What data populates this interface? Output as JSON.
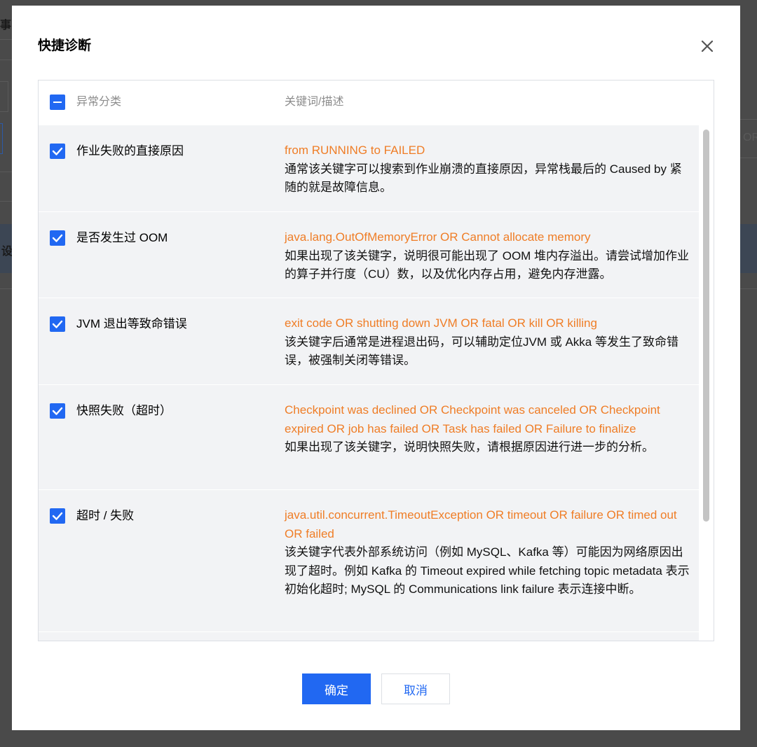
{
  "background": {
    "frag_top": "事",
    "frag_mid": "设",
    "frag_right": "OR"
  },
  "modal": {
    "title": "快捷诊断",
    "close_icon": "close-icon"
  },
  "table": {
    "headers": {
      "category": "异常分类",
      "keywords": "关键词/描述"
    },
    "header_checkbox_state": "indeterminate",
    "rows": [
      {
        "checked": true,
        "name": "作业失败的直接原因",
        "keywords": "from RUNNING to FAILED",
        "description": "通常该关键字可以搜索到作业崩溃的直接原因，异常栈最后的 Caused by 紧随的就是故障信息。"
      },
      {
        "checked": true,
        "name": "是否发生过 OOM",
        "keywords": "java.lang.OutOfMemoryError OR Cannot allocate memory",
        "description": "如果出现了该关键字，说明很可能出现了 OOM 堆内存溢出。请尝试增加作业的算子并行度（CU）数，以及优化内存占用，避免内存泄露。"
      },
      {
        "checked": true,
        "name": "JVM 退出等致命错误",
        "keywords": "exit code OR shutting down JVM OR fatal OR kill OR killing",
        "description": "该关键字后通常是进程退出码，可以辅助定位JVM 或 Akka 等发生了致命错误，被强制关闭等错误。"
      },
      {
        "checked": true,
        "name": "快照失败（超时）",
        "keywords": "Checkpoint was declined OR Checkpoint was canceled OR Checkpoint expired OR job has failed OR Task has failed OR Failure to finalize",
        "description": "如果出现了该关键字，说明快照失败，请根据原因进行进一步的分析。"
      },
      {
        "checked": true,
        "name": "超时 / 失败",
        "keywords": "java.util.concurrent.TimeoutException OR timeout OR failure OR timed out OR failed",
        "description": "该关键字代表外部系统访问（例如 MySQL、Kafka 等）可能因为网络原因出现了超时。例如 Kafka 的 Timeout expired while fetching topic metadata 表示初始化超时; MySQL 的 Communications link failure 表示连接中断。"
      }
    ]
  },
  "footer": {
    "confirm_label": "确定",
    "cancel_label": "取消"
  },
  "colors": {
    "primary": "#2168f2",
    "keyword": "#ef7d26",
    "row_bg": "#f2f3f5",
    "overlay": "#3a3a3a"
  }
}
